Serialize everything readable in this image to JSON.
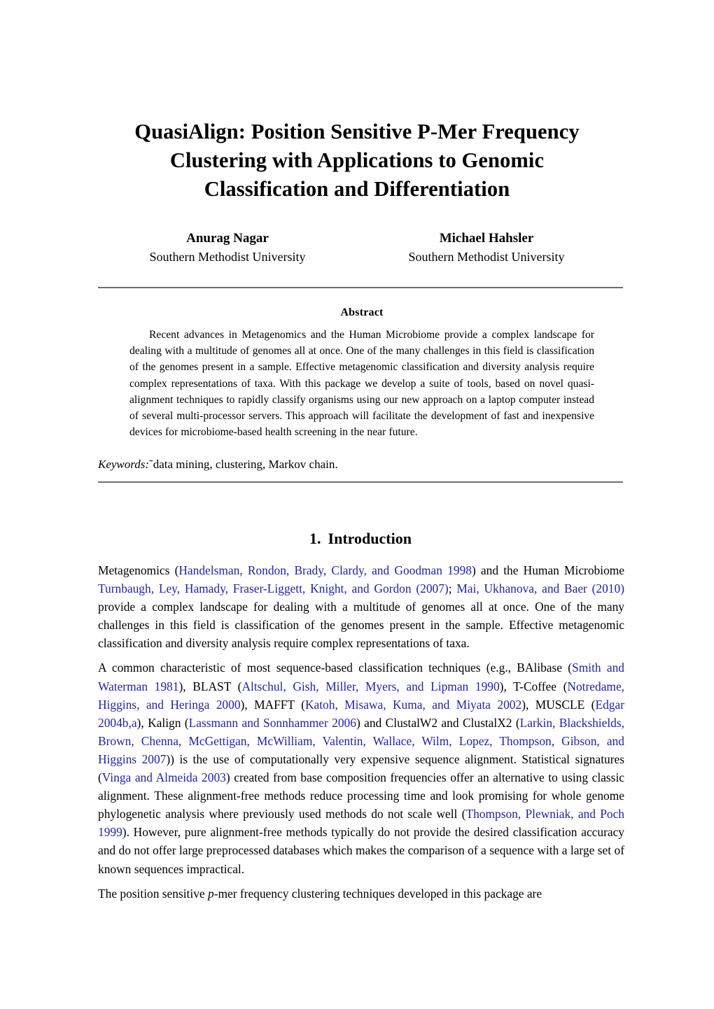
{
  "paper": {
    "title_lines": [
      "QuasiAlign: Position Sensitive P-Mer Frequency",
      "Clustering with Applications to Genomic",
      "Classification and Differentiation"
    ],
    "authors": [
      {
        "name": "Anurag Nagar",
        "affiliation": "Southern Methodist University"
      },
      {
        "name": "Michael Hahsler",
        "affiliation": "Southern Methodist University"
      }
    ],
    "abstract": {
      "heading": "Abstract",
      "text": "Recent advances in Metagenomics and the Human Microbiome provide a complex landscape for dealing with a multitude of genomes all at once. One of the many challenges in this field is classification of the genomes present in a sample. Effective metagenomic classification and diversity analysis require complex representations of taxa. With this package we develop a suite of tools, based on novel quasi-alignment techniques to rapidly classify organisms using our new approach on a laptop computer instead of several multi-processor servers. This approach will facilitate the development of fast and inexpensive devices for microbiome-based health screening in the near future."
    },
    "keywords": {
      "label": "Keywords:",
      "separator": "˜",
      "value": "data mining, clustering, Markov chain."
    },
    "section": {
      "number": "1.",
      "title": "Introduction"
    },
    "paragraphs": [
      {
        "id": "p1",
        "runs": [
          {
            "t": "Metagenomics (",
            "c": "plain"
          },
          {
            "t": "Handelsman, Rondon, Brady, Clardy, and Goodman 1998",
            "c": "cite"
          },
          {
            "t": ") and the Human Microbiome ",
            "c": "plain"
          },
          {
            "t": "Turnbaugh, Ley, Hamady, Fraser-Liggett, Knight, and Gordon (2007)",
            "c": "cite"
          },
          {
            "t": "; ",
            "c": "plain"
          },
          {
            "t": "Mai, Ukhanova, and Baer (2010)",
            "c": "cite"
          },
          {
            "t": " provide a complex landscape for dealing with a multitude of genomes all at once. One of the many challenges in this field is classification of the genomes present in the sample. Effective metagenomic classification and diversity analysis require complex representations of taxa.",
            "c": "plain"
          }
        ]
      },
      {
        "id": "p2",
        "runs": [
          {
            "t": "A common characteristic of most sequence-based classification techniques (e.g., BAlibase (",
            "c": "plain"
          },
          {
            "t": "Smith and Waterman 1981",
            "c": "cite"
          },
          {
            "t": "), BLAST (",
            "c": "plain"
          },
          {
            "t": "Altschul, Gish, Miller, Myers, and Lipman 1990",
            "c": "cite"
          },
          {
            "t": "), T-Coffee (",
            "c": "plain"
          },
          {
            "t": "Notredame, Higgins, and Heringa 2000",
            "c": "cite"
          },
          {
            "t": "), MAFFT (",
            "c": "plain"
          },
          {
            "t": "Katoh, Misawa, Kuma, and Miyata 2002",
            "c": "cite"
          },
          {
            "t": "), MUSCLE (",
            "c": "plain"
          },
          {
            "t": "Edgar 2004b,a",
            "c": "cite"
          },
          {
            "t": "), Kalign (",
            "c": "plain"
          },
          {
            "t": "Lassmann and Sonnhammer 2006",
            "c": "cite"
          },
          {
            "t": ") and ClustalW2 and ClustalX2 (",
            "c": "plain"
          },
          {
            "t": "Larkin, Blackshields, Brown, Chenna, McGettigan, McWilliam, Valentin, Wallace, Wilm, Lopez, Thompson, Gibson, and Higgins 2007",
            "c": "cite"
          },
          {
            "t": ")) is the use of computationally very expensive sequence alignment. Statistical signatures (",
            "c": "plain"
          },
          {
            "t": "Vinga and Almeida 2003",
            "c": "cite"
          },
          {
            "t": ") created from base composition frequencies offer an alternative to using classic alignment. These alignment-free methods reduce processing time and look promising for whole genome phylogenetic analysis where previously used methods do not scale well (",
            "c": "plain"
          },
          {
            "t": "Thompson, Plewniak, and Poch 1999",
            "c": "cite"
          },
          {
            "t": "). However, pure alignment-free methods typically do not provide the desired classification accuracy and do not offer large preprocessed databases which makes the comparison of a sequence with a large set of known sequences impractical.",
            "c": "plain"
          }
        ]
      },
      {
        "id": "p3",
        "runs": [
          {
            "t": "The position sensitive ",
            "c": "plain"
          },
          {
            "t": "p",
            "c": "italic"
          },
          {
            "t": "-mer frequency clustering techniques developed in this package are",
            "c": "plain"
          }
        ]
      }
    ],
    "colors": {
      "citation_link": "#2222aa",
      "text": "#000000",
      "rule": "#6e6e6e",
      "background": "#ffffff"
    }
  }
}
